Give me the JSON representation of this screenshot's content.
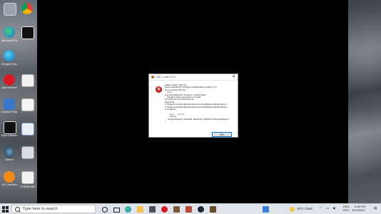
{
  "desktop": {
    "left_labels": [
      "Microsoft Edge",
      "",
      "Google Chrome",
      "",
      "Opera Browser",
      "",
      "Control Panel",
      "",
      "Epic Games Launcher",
      "",
      "Steam",
      "",
      "VLC media player",
      "UVB3DOBS"
    ],
    "right_labels": []
  },
  "dialog": {
    "title": "XML Load Error",
    "close_glyph": "✕",
    "error_glyph": "×",
    "message": "Failed loading XML file\nandCoreaddons/C:\\Program Files\\Fullslot 1.9\\lab 1.6.0\nError parsing XML file...\n    Line...\nand.Coreaddons/C:\\Program...Fullslot.Files\n    Reading: Element content is invalid\naccording to the DTD/Schema.\nExpecting:\nC:\\Program Files\\Fullslot\\Fullslot\\Overworld\\Region\\RegionName,\nC:\\Program Files\\Fullslot\\Fullslot\\Overworld\\Region\\Region\\Button,\nC:\\Program...\n\n        Line:      12, 13\n        Source:\n    <Region\\Region>PLEASE_REGION_DIVISION</Region\\Region>\n>",
    "ok_label": "OK"
  },
  "taskbar": {
    "search_placeholder": "Type here to search",
    "weather": "19°C  Clear",
    "lang_top": "ENG",
    "lang_bottom": "INTL",
    "time": "5:45 PM",
    "date": "8/12/2021"
  },
  "colors": {
    "error_red": "#d32f2f",
    "button_border": "#0078d7"
  }
}
